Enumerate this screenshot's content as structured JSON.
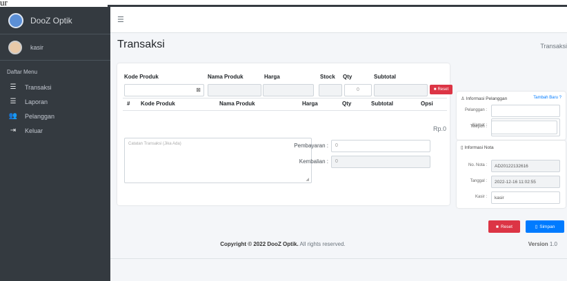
{
  "overlay_text": "ur",
  "brand": {
    "name": "DooZ Optik"
  },
  "user": {
    "name": "kasir"
  },
  "sidebar": {
    "heading": "Daftar Menu",
    "items": [
      {
        "label": "Transaksi",
        "icon": "list-icon"
      },
      {
        "label": "Laporan",
        "icon": "list-icon"
      },
      {
        "label": "Pelanggan",
        "icon": "users-icon"
      },
      {
        "label": "Keluar",
        "icon": "sign-out-icon"
      }
    ]
  },
  "header": {
    "menu_icon": "hamburger-icon"
  },
  "page": {
    "title": "Transaksi",
    "breadcrumb": "Transaksi"
  },
  "form": {
    "kode_label": "Kode Produk",
    "nama_label": "Nama Produk",
    "harga_label": "Harga",
    "stock_label": "Stock",
    "qty_label": "Qty",
    "subtotal_label": "Subtotal",
    "qty_value": "0",
    "reset_label": "Reset"
  },
  "table": {
    "headers": [
      "#",
      "Kode Produk",
      "Nama Produk",
      "Harga",
      "Qty",
      "Subtotal",
      "Opsi"
    ]
  },
  "total": "Rp.0",
  "notes_placeholder": "Catatan Transaksi (Jika Ada)",
  "payment": {
    "pembayaran_label": "Pembayaran :",
    "pembayaran_value": "0",
    "kembalian_label": "Kembalian :",
    "kembalian_value": "0"
  },
  "customer": {
    "title": "Informasi Pelanggan",
    "add_link": "Tambah Baru ?",
    "pelanggan_label": "Pelanggan :",
    "telepon_label": "Telepon :",
    "alamat_label": "Alamat :"
  },
  "nota": {
    "title": "Informasi Nota",
    "no_label": "No. Nota :",
    "no_value": "AD20122132616",
    "tanggal_label": "Tanggal :",
    "tanggal_value": "2022-12-16 11:02:55",
    "kasir_label": "Kasir :",
    "kasir_value": "kasir"
  },
  "buttons": {
    "reset": "Reset",
    "simpan": "Simpan"
  },
  "footer": {
    "copyright_prefix": "Copyright © 2022",
    "copyright_brand": "DooZ Optik.",
    "copyright_suffix": "All rights reserved.",
    "version_label": "Version",
    "version_value": "1.0"
  },
  "colors": {
    "sidebar": "#343a40",
    "danger": "#dc3545",
    "primary": "#007bff"
  }
}
